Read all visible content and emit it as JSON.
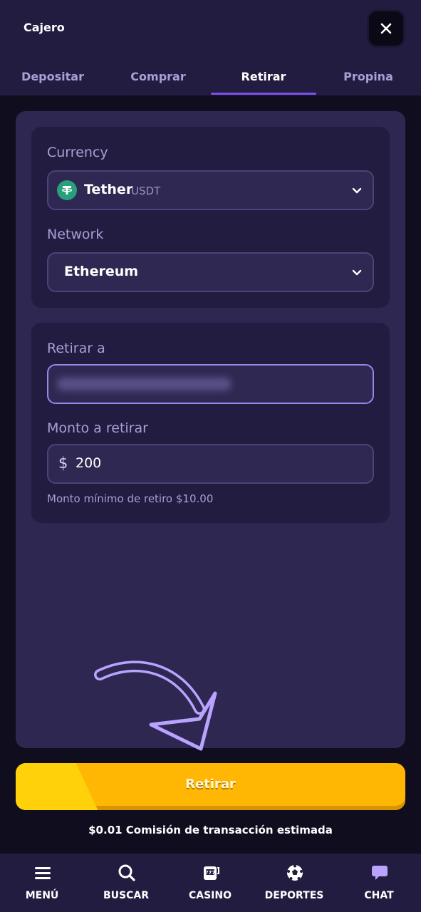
{
  "header": {
    "title": "Cajero",
    "tabs": [
      {
        "label": "Depositar"
      },
      {
        "label": "Comprar"
      },
      {
        "label": "Retirar"
      },
      {
        "label": "Propina"
      }
    ],
    "active_tab": "Retirar"
  },
  "currency_section": {
    "currency_label": "Currency",
    "currency_name": "Tether",
    "currency_code": "USDT",
    "network_label": "Network",
    "network_value": "Ethereum"
  },
  "withdraw_section": {
    "address_label": "Retirar a",
    "amount_label": "Monto a retirar",
    "currency_symbol": "$",
    "amount_value": "200",
    "min_hint": "Monto mínimo de retiro $10.00"
  },
  "cta": {
    "label": "Retirar"
  },
  "fee_text": "$0.01 Comisión de transacción estimada",
  "bottom_nav": [
    {
      "label": "MENÚ",
      "icon": "menu-icon"
    },
    {
      "label": "BUSCAR",
      "icon": "search-icon"
    },
    {
      "label": "CASINO",
      "icon": "slot-machine-icon"
    },
    {
      "label": "DEPORTES",
      "icon": "soccer-ball-icon"
    },
    {
      "label": "CHAT",
      "icon": "chat-bubble-icon"
    }
  ],
  "colors": {
    "accent": "#7b52e8",
    "cta": "#ffb703",
    "tether": "#26a17b",
    "chat_icon": "#b9a3ff"
  }
}
